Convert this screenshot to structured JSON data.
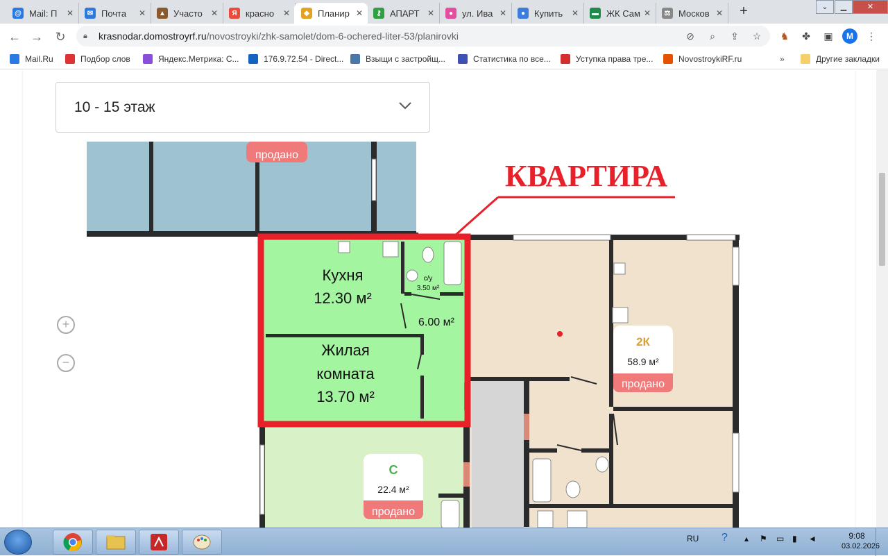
{
  "tabs": [
    {
      "label": "Mail: П",
      "color": "#2a7ae2",
      "glyph": "@",
      "active": false
    },
    {
      "label": "Почта",
      "color": "#2a7ae2",
      "glyph": "✉",
      "active": false
    },
    {
      "label": "Участо",
      "color": "#8a5a2c",
      "glyph": "▲",
      "active": false
    },
    {
      "label": "красно",
      "color": "#e94b3c",
      "glyph": "Я",
      "active": false
    },
    {
      "label": "Планир",
      "color": "#e3a224",
      "glyph": "◆",
      "active": true
    },
    {
      "label": "АПАРТ",
      "color": "#2ea043",
      "glyph": "⚷",
      "active": false
    },
    {
      "label": "ул. Ива",
      "color": "#e34fa0",
      "glyph": "●",
      "active": false
    },
    {
      "label": "Купить",
      "color": "#3b7ddd",
      "glyph": "●",
      "active": false
    },
    {
      "label": "ЖК Сам",
      "color": "#1f8a4c",
      "glyph": "▬",
      "active": false
    },
    {
      "label": "Москов",
      "color": "#888888",
      "glyph": "⚖",
      "active": false
    }
  ],
  "address": {
    "host": "krasnodar.domostroyrf.ru",
    "path": "/novostroyki/zhk-samolet/dom-6-ochered-liter-53/planirovki"
  },
  "profile_initial": "M",
  "bookmarks": [
    {
      "label": "Mail.Ru",
      "color": "#2a7ae2"
    },
    {
      "label": "Подбор слов",
      "color": "#d33"
    },
    {
      "label": "Яндекс.Метрика: С...",
      "color": "#8a4fd8"
    },
    {
      "label": "176.9.72.54 - Direct...",
      "color": "#1565c0"
    },
    {
      "label": "Взыщи с застройщ...",
      "color": "#4a76a8"
    },
    {
      "label": "Статистика по все...",
      "color": "#3f51b5"
    },
    {
      "label": "Уступка права тре...",
      "color": "#d32f2f"
    },
    {
      "label": "NovostroykiRF.ru",
      "color": "#e65100"
    }
  ],
  "bookmarks_more": "»",
  "other_bookmarks": "Другие закладки",
  "floor_select": {
    "value": "10 - 15 этаж"
  },
  "zoom": {
    "in": "+",
    "out": "−"
  },
  "annotation": {
    "text": "КВАРТИРА",
    "color": "#e8202a"
  },
  "status": {
    "sold": "продано",
    "sold_color": "#f07a7a"
  },
  "rooms": {
    "kitchen": {
      "name": "Кухня",
      "area": "12.30 м²"
    },
    "living": {
      "name_line1": "Жилая",
      "name_line2": "комната",
      "area": "13.70 м²"
    },
    "hall": {
      "area": "6.00 м²"
    },
    "bath": {
      "name": "с/у",
      "area": "3.50 м²"
    }
  },
  "units": {
    "two_room": {
      "type": "2К",
      "area": "58.9 м²",
      "type_color": "#e0a030"
    },
    "studio": {
      "type": "С",
      "area": "22.4 м²",
      "type_color": "#4caf50"
    }
  },
  "colors": {
    "selected_apartment": "#a3f5a0",
    "studio_fill": "#d9f1c6",
    "two_room_fill": "#f0e2cd",
    "top_left_fill": "#9fc2d0",
    "corridor": "#d6d6d6",
    "highlight": "#e8202a",
    "wall": "#2b2b2b"
  },
  "taskbar": {
    "lang": "RU",
    "time": "9:08",
    "date": "03.02.2026"
  }
}
